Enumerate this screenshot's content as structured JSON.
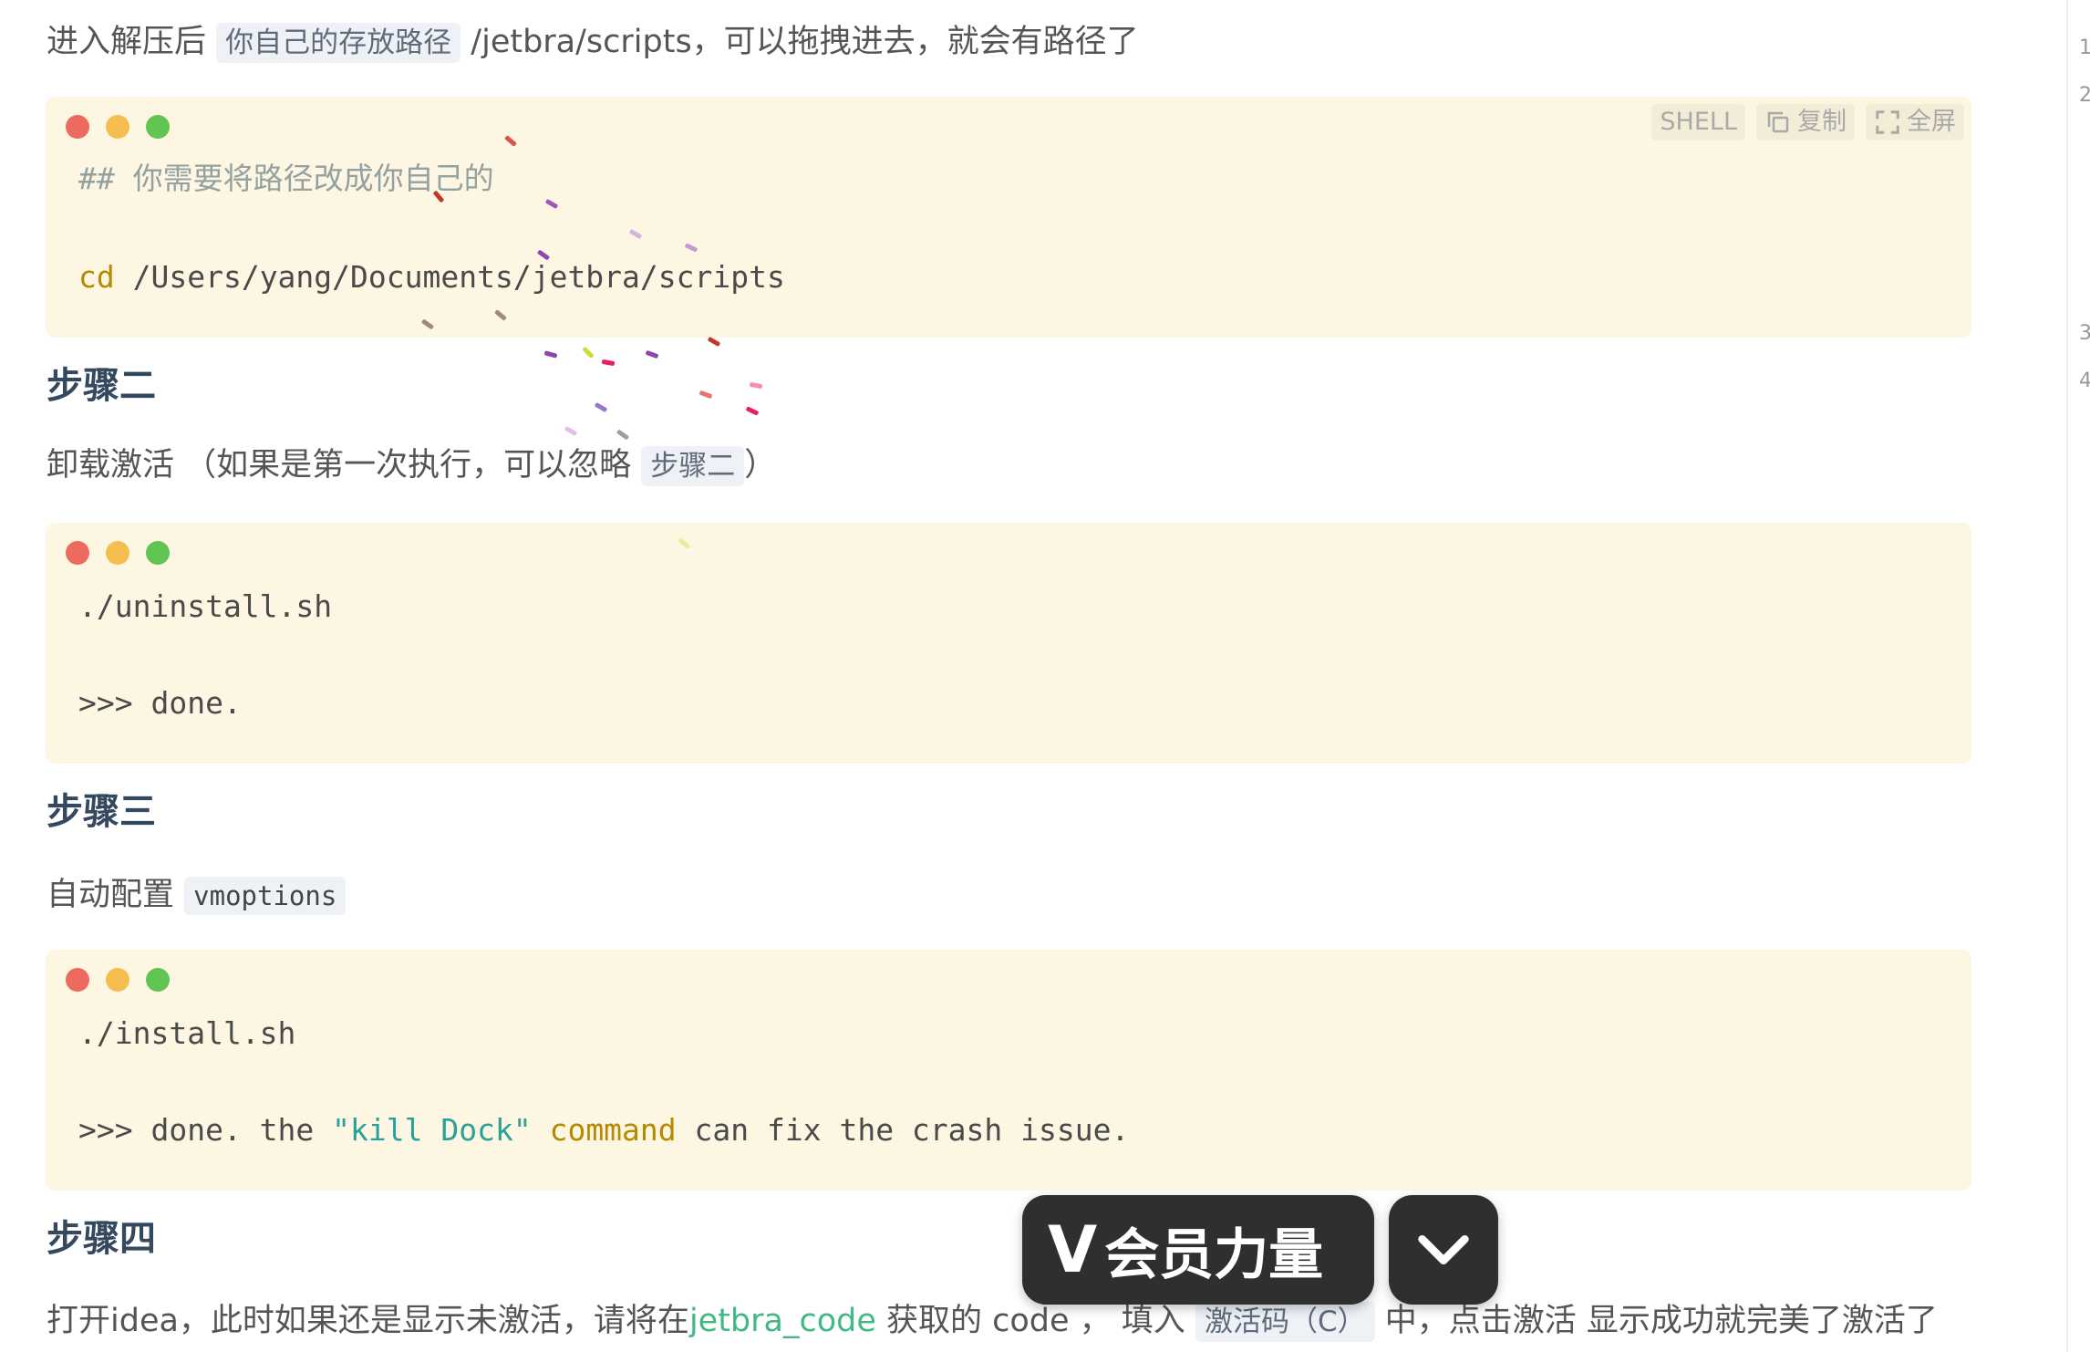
{
  "intro": {
    "prefix": "进入解压后",
    "inline_code": "你自己的存放路径",
    "suffix": "/jetbra/scripts，可以拖拽进去，就会有路径了"
  },
  "block1": {
    "lang": "SHELL",
    "copy_label": "复制",
    "fullscreen_label": "全屏",
    "comment_hash": "##",
    "comment_text": "你需要将路径改成你自己的",
    "cmd_kw": "cd",
    "cmd_path": " /Users/yang/Documents/jetbra/scripts"
  },
  "step2": {
    "title": "步骤二",
    "desc_prefix": "卸载激活 （如果是第一次执行，可以忽略",
    "desc_code": "步骤二",
    "desc_suffix": "）"
  },
  "block2": {
    "line1": "./uninstall.sh",
    "line2": ">>> done."
  },
  "step3": {
    "title": "步骤三",
    "desc_prefix": "自动配置",
    "desc_code": "vmoptions"
  },
  "block3": {
    "line1": "./install.sh",
    "line2_a": ">>> done. the ",
    "line2_str": "\"kill Dock\"",
    "line2_kw": "command",
    "line2_b": " can fix the crash issue."
  },
  "step4": {
    "title": "步骤四",
    "desc_a": "打开idea，此时如果还是显示未激活，请将在",
    "desc_link": "jetbra_code",
    "desc_b": " 获取的 code ， 填入",
    "desc_code": "激活码（C）",
    "desc_c": "中，点击激活 显示成功就完美了激活了"
  },
  "overlay": {
    "vip_v": "V",
    "vip_label": "会员力量"
  },
  "right_numbers": [
    "1",
    "2",
    "3",
    "4"
  ]
}
